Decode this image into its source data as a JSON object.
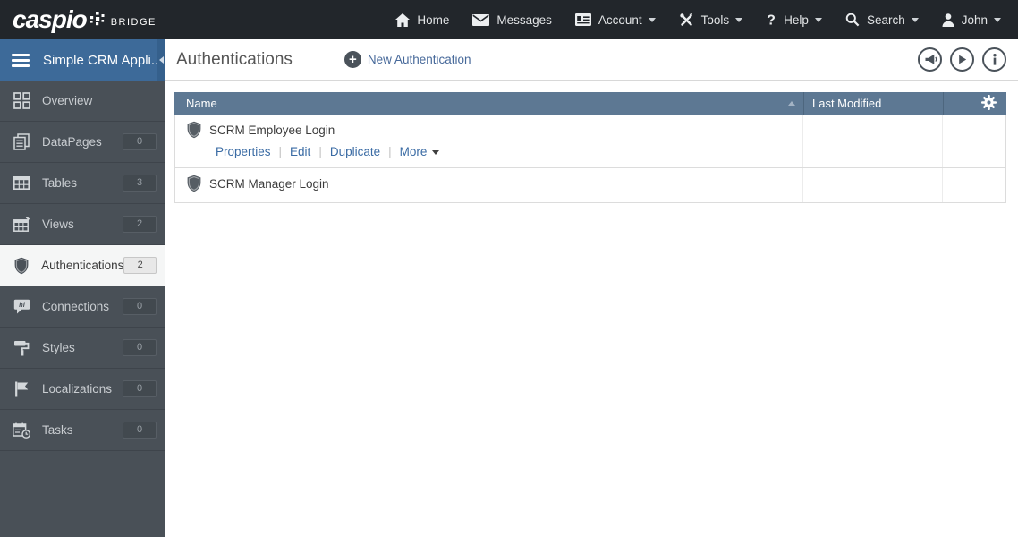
{
  "topbar": {
    "logo": {
      "brand": "caspio",
      "suffix": "BRIDGE"
    },
    "nav": [
      {
        "label": "Home",
        "icon": "home-icon",
        "caret": false
      },
      {
        "label": "Messages",
        "icon": "messages-icon",
        "caret": false
      },
      {
        "label": "Account",
        "icon": "account-icon",
        "caret": true
      },
      {
        "label": "Tools",
        "icon": "tools-icon",
        "caret": true
      },
      {
        "label": "Help",
        "icon": "help-icon",
        "caret": true
      },
      {
        "label": "Search",
        "icon": "search-icon",
        "caret": true
      },
      {
        "label": "John",
        "icon": "user-icon",
        "caret": true
      }
    ]
  },
  "sidebar": {
    "app_title": "Simple CRM Appli...",
    "items": [
      {
        "label": "Overview",
        "icon": "overview-icon",
        "badge": null,
        "active": false
      },
      {
        "label": "DataPages",
        "icon": "datapages-icon",
        "badge": "0",
        "active": false
      },
      {
        "label": "Tables",
        "icon": "tables-icon",
        "badge": "3",
        "active": false
      },
      {
        "label": "Views",
        "icon": "views-icon",
        "badge": "2",
        "active": false
      },
      {
        "label": "Authentications",
        "icon": "shield-icon",
        "badge": "2",
        "active": true
      },
      {
        "label": "Connections",
        "icon": "connections-icon",
        "badge": "0",
        "active": false
      },
      {
        "label": "Styles",
        "icon": "styles-icon",
        "badge": "0",
        "active": false
      },
      {
        "label": "Localizations",
        "icon": "localizations-icon",
        "badge": "0",
        "active": false
      },
      {
        "label": "Tasks",
        "icon": "tasks-icon",
        "badge": "0",
        "active": false
      }
    ]
  },
  "main": {
    "page_title": "Authentications",
    "new_button_label": "New Authentication",
    "header_icons": [
      {
        "name": "megaphone-icon"
      },
      {
        "name": "play-icon"
      },
      {
        "name": "info-icon"
      }
    ],
    "table": {
      "columns": [
        {
          "label": "Name",
          "sort": "asc"
        },
        {
          "label": "Last Modified",
          "sort": null
        }
      ],
      "action_separator": "|",
      "rows": [
        {
          "name": "SCRM Employee Login",
          "last_modified": "",
          "actions": [
            {
              "label": "Properties",
              "caret": false
            },
            {
              "label": "Edit",
              "caret": false
            },
            {
              "label": "Duplicate",
              "caret": false
            },
            {
              "label": "More",
              "caret": true
            }
          ]
        },
        {
          "name": "SCRM Manager Login",
          "last_modified": "",
          "actions": null
        }
      ]
    }
  },
  "colors": {
    "topbar_bg": "#22262b",
    "sidebar_bg": "#495057",
    "sidebar_header_bg": "#3d6a99",
    "table_header_bg": "#5d7893",
    "link_blue": "#3a6ba4"
  }
}
